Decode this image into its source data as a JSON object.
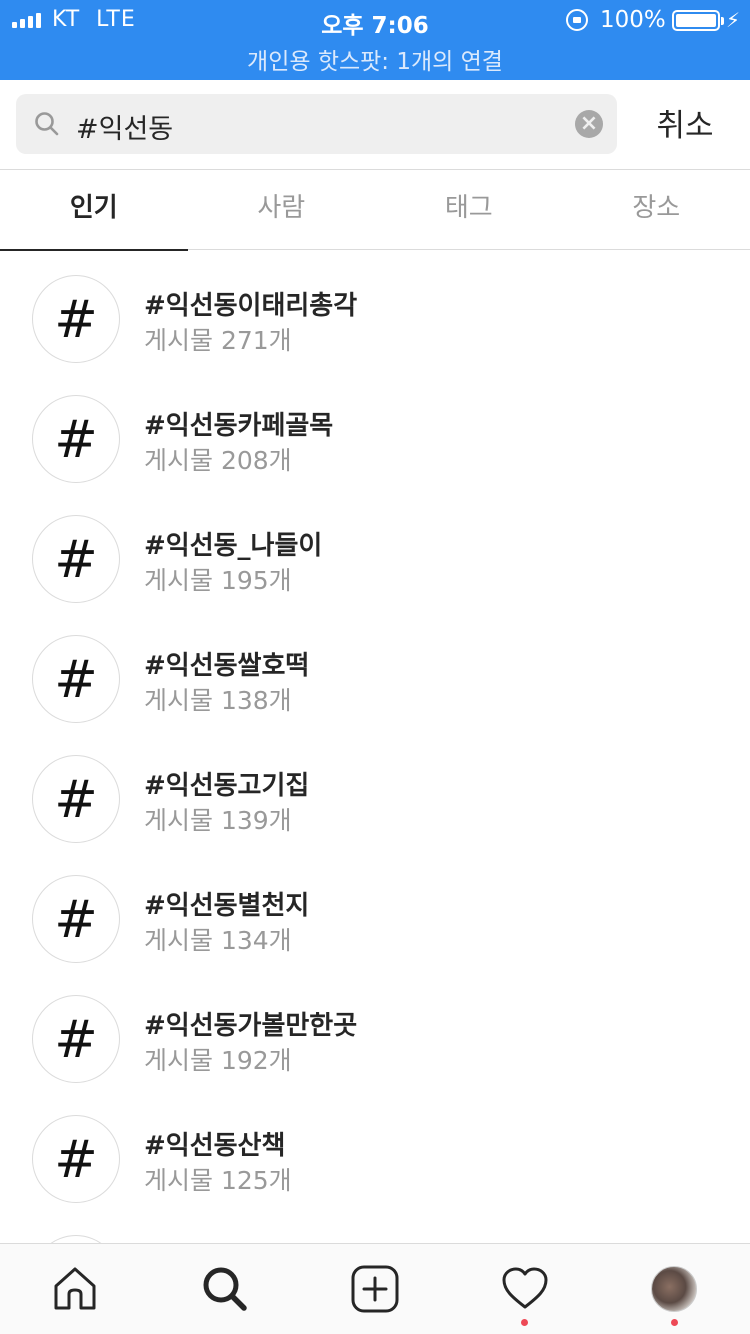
{
  "status_bar": {
    "carrier": "KT",
    "network": "LTE",
    "time": "오후 7:06",
    "battery": "100%",
    "hotspot": "개인용 핫스팟: 1개의 연결",
    "accent_color": "#2f8bf0"
  },
  "search": {
    "query": "#익선동",
    "cancel_label": "취소"
  },
  "tabs": [
    {
      "label": "인기",
      "active": true
    },
    {
      "label": "사람",
      "active": false
    },
    {
      "label": "태그",
      "active": false
    },
    {
      "label": "장소",
      "active": false
    }
  ],
  "results": [
    {
      "icon": "#",
      "title": "#익선동이태리총각",
      "subtitle": "게시물 271개"
    },
    {
      "icon": "#",
      "title": "#익선동카페골목",
      "subtitle": "게시물 208개"
    },
    {
      "icon": "#",
      "title": "#익선동_나들이",
      "subtitle": "게시물 195개"
    },
    {
      "icon": "#",
      "title": "#익선동쌀호떡",
      "subtitle": "게시물 138개"
    },
    {
      "icon": "#",
      "title": "#익선동고기집",
      "subtitle": "게시물 139개"
    },
    {
      "icon": "#",
      "title": "#익선동별천지",
      "subtitle": "게시물 134개"
    },
    {
      "icon": "#",
      "title": "#익선동가볼만한곳",
      "subtitle": "게시물 192개"
    },
    {
      "icon": "#",
      "title": "#익선동산책",
      "subtitle": "게시물 125개"
    }
  ],
  "bottom_nav": {
    "items": [
      "home-icon",
      "search-icon",
      "add-post-icon",
      "heart-icon",
      "profile-avatar"
    ],
    "notification_color": "#ed4956"
  }
}
